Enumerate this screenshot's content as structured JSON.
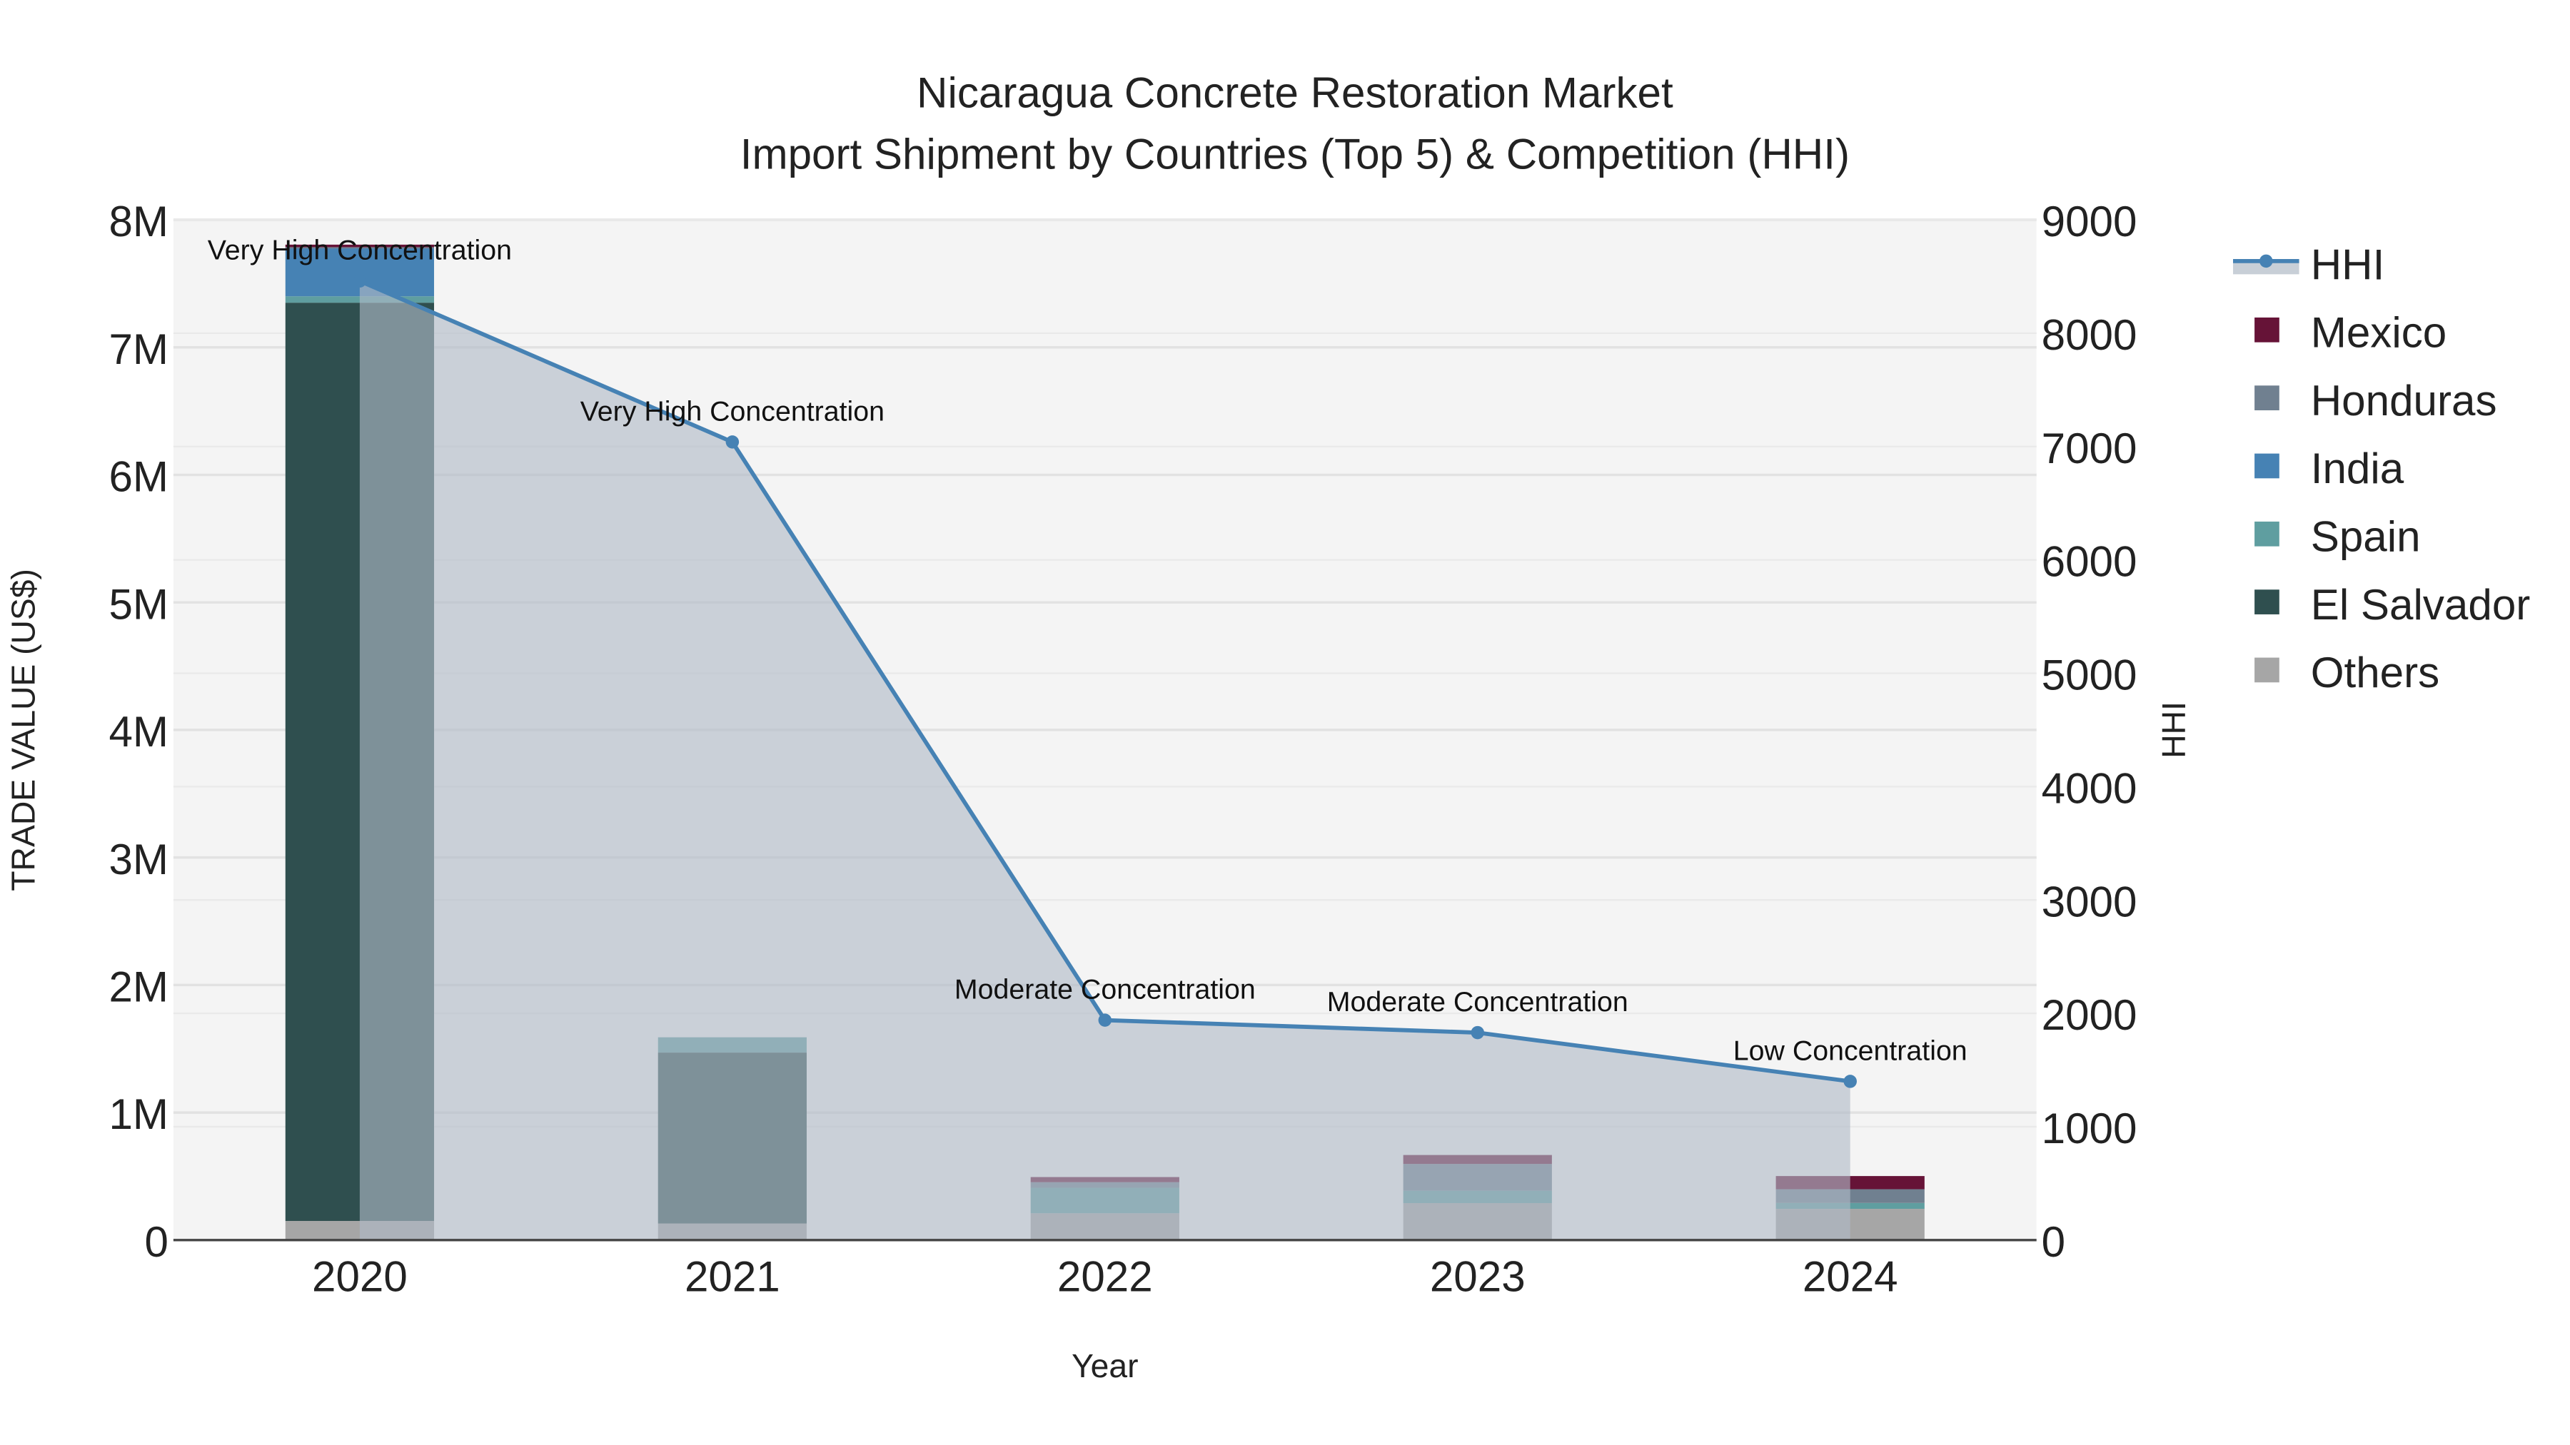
{
  "chart_data": {
    "type": "bar",
    "title": "Nicaragua Concrete Restoration Market",
    "subtitle": "Import Shipment by Countries (Top 5) & Competition (HHI)",
    "xlabel": "Year",
    "ylabel": "TRADE VALUE (US$)",
    "y2label": "HHI",
    "categories": [
      "2020",
      "2021",
      "2022",
      "2023",
      "2024"
    ],
    "ylim": [
      0,
      8000000
    ],
    "y2lim": [
      0,
      9000
    ],
    "yticks": [
      {
        "v": 0,
        "label": "0"
      },
      {
        "v": 1000000,
        "label": "1M"
      },
      {
        "v": 2000000,
        "label": "2M"
      },
      {
        "v": 3000000,
        "label": "3M"
      },
      {
        "v": 4000000,
        "label": "4M"
      },
      {
        "v": 5000000,
        "label": "5M"
      },
      {
        "v": 6000000,
        "label": "6M"
      },
      {
        "v": 7000000,
        "label": "7M"
      },
      {
        "v": 8000000,
        "label": "8M"
      }
    ],
    "y2ticks": [
      "0",
      "1000",
      "2000",
      "3000",
      "4000",
      "5000",
      "6000",
      "7000",
      "8000",
      "9000"
    ],
    "grid": true,
    "legend_position": "right",
    "series": [
      {
        "name": "Others",
        "color": "#a6a6a6",
        "values": [
          150000,
          130000,
          210000,
          290000,
          245000
        ]
      },
      {
        "name": "El Salvador",
        "color": "#2f4f4f",
        "values": [
          7200000,
          1340000,
          0,
          0,
          0
        ]
      },
      {
        "name": "Spain",
        "color": "#5f9ea0",
        "values": [
          50000,
          120000,
          200000,
          97000,
          46000
        ]
      },
      {
        "name": "India",
        "color": "#4682b4",
        "values": [
          380000,
          0,
          0,
          0,
          0
        ]
      },
      {
        "name": "Honduras",
        "color": "#708090",
        "values": [
          5000,
          0,
          44000,
          210000,
          108000
        ]
      },
      {
        "name": "Mexico",
        "color": "#661337",
        "values": [
          20000,
          0,
          40000,
          70000,
          103000
        ]
      }
    ],
    "hhi": {
      "name": "HHI",
      "color": "#4682b4",
      "values": [
        8460,
        7040,
        1940,
        1830,
        1400
      ],
      "annotations": [
        "Very High Concentration",
        "Very High Concentration",
        "Moderate Concentration",
        "Moderate Concentration",
        "Low Concentration"
      ]
    },
    "legend_order": [
      "HHI",
      "Mexico",
      "Honduras",
      "India",
      "Spain",
      "El Salvador",
      "Others"
    ]
  }
}
